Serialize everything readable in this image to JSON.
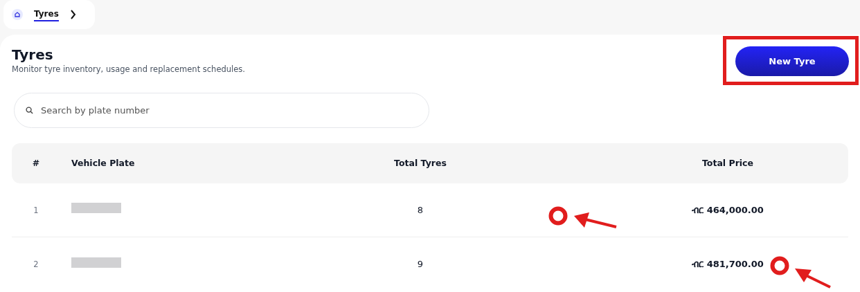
{
  "breadcrumb": {
    "items": [
      {
        "label": "Tyres",
        "selected": true
      }
    ]
  },
  "page": {
    "title": "Tyres",
    "subtitle": "Monitor tyre inventory, usage and replacement schedules.",
    "new_button": "New Tyre"
  },
  "search": {
    "placeholder": "Search by plate number"
  },
  "table": {
    "columns": [
      "#",
      "Vehicle Plate",
      "Total Tyres",
      "Total Price"
    ],
    "rows": [
      {
        "index": "1",
        "plate_redacted": true,
        "total_tyres": "8",
        "total_price": "ብር 464,000.00"
      },
      {
        "index": "2",
        "plate_redacted": true,
        "total_tyres": "9",
        "total_price": "ብር 481,700.00"
      }
    ]
  }
}
